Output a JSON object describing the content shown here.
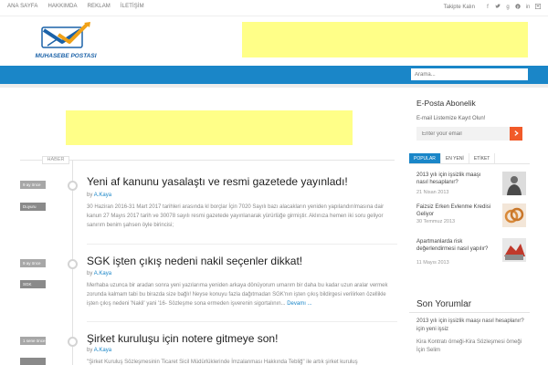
{
  "topnav": {
    "items": [
      "ANA SAYFA",
      "HAKKIMDA",
      "REKLAM",
      "İLETİŞİM"
    ],
    "follow_label": "Takipte Kalın",
    "social_icons": [
      "facebook-icon",
      "twitter-icon",
      "google-plus-icon",
      "pinterest-icon",
      "linkedin-icon",
      "rss-icon"
    ]
  },
  "header": {
    "logo_text": "MUHASEBE POSTASI",
    "brand_color": "#1a86c8",
    "ad_color": "#ffff88"
  },
  "navbar": {
    "search_placeholder": "Arama..."
  },
  "timeline": {
    "label": "HABER"
  },
  "posts": [
    {
      "ago": "9 ay önce",
      "category": "Duyuru",
      "title": "Yeni af kanunu yasalaştı ve resmi gazetede yayınladı!",
      "by": "by",
      "author": "A.Kaya",
      "excerpt": "30 Haziran 2016-31 Mart 2017 tarihleri arasında kl borçlar İçin 7020 Sayılı bazı alacakların yeniden yapılandırılmasına dair kanun 27 Mayıs 2017 tarih ve 30078 sayılı resmi gazetede yayınlanarak yürürlüğe girmiştir. Aklınıza hemen iki soru geliyor sanırım benim şahsen öyle birincisi;",
      "more": ""
    },
    {
      "ago": "9 ay önce",
      "category": "SGK",
      "title": "SGK işten çıkış nedeni nakil seçenler dikkat!",
      "by": "by",
      "author": "A.Kaya",
      "excerpt": "Merhaba uzunca bir aradan sonra yeni yazılarıma yeniden arkaya dönüyorum umarım bir daha bu kadar uzun aralar vermek zorunda kalmam tabi bu birazda size bağlı! Neyse konuyu fazla dağıtmadan SGK'nın işten çıkış bildirgesi verilirken özellikle işten çıkış nedeni 'Nakil' yani '16- Sözleşme sona ermeden işverenin sigortalının...",
      "more": "Devamı ..."
    },
    {
      "ago": "1 sene önce",
      "category": "",
      "title": "Şirket kuruluşu için notere gitmeye son!",
      "by": "by",
      "author": "A.Kaya",
      "excerpt": "\"Şirket Kuruluş Sözleşmesinin Ticaret Sicil Müdürlüklerinde İmzalanması Hakkında Tebliğ\" ile artık şirket kuruluş",
      "more": ""
    }
  ],
  "sidebar": {
    "email_title": "E-Posta Abonelik",
    "email_desc": "E-mail Listemize Kayıt Olun!",
    "email_placeholder": "Enter your email",
    "email_button_icon": "arrow-right-icon",
    "tabs": [
      "POPULAR",
      "EN YENİ",
      "ETİKET"
    ],
    "popular": [
      {
        "title": "2013 yılı için işsizlik maaşı nasıl hesaplanır?",
        "date": "21 Nisan 2013"
      },
      {
        "title": "Faizsiz Erken Evlenme Kredisi Geliyor",
        "date": "30 Temmuz 2013"
      },
      {
        "title": "Apartmanlarda risk değerlendirmesi nasıl yapılır?",
        "date": "11 Mayıs 2013"
      }
    ],
    "comments_title": "Son Yorumlar",
    "comments": [
      "2013 yılı için işsizlik maaşı nasıl hesaplanır? için yeni işsiz",
      "Kira Kontratı örneği-Kira Sözleşmesi örneği İçin Selim"
    ]
  }
}
